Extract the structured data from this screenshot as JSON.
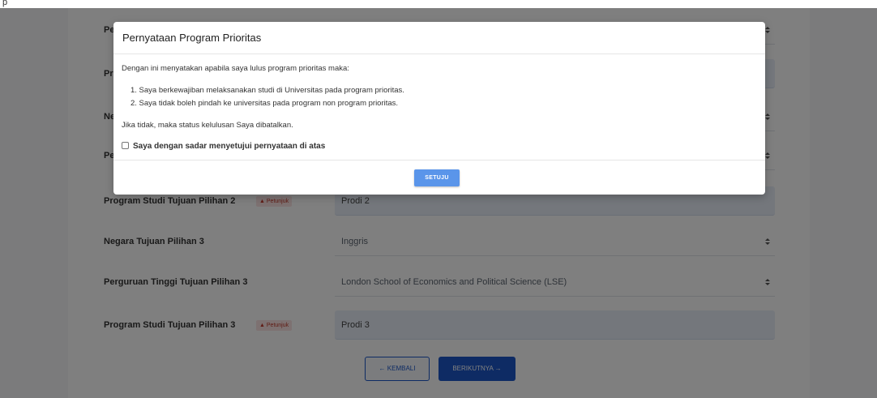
{
  "topbar": {
    "glyph": "p"
  },
  "form": {
    "hidden_labels": [
      "Pe",
      "Pro",
      "Ne",
      "Pe"
    ],
    "rows": [
      {
        "label": "Program Studi Tujuan Pilihan 2",
        "badge": "Petunjuk",
        "value": "Prodi 2",
        "kind": "input"
      },
      {
        "label": "Negara Tujuan Pilihan 3",
        "value": "Inggris",
        "kind": "select"
      },
      {
        "label": "Perguruan Tinggi Tujuan Pilihan 3",
        "value": "London School of Economics and Political Science (LSE)",
        "kind": "select"
      },
      {
        "label": "Program Studi Tujuan Pilihan 3",
        "badge": "Petunjuk",
        "value": "Prodi 3",
        "kind": "input"
      }
    ],
    "back_label": "← KEMBALI",
    "next_label": "BERIKUTNYA →"
  },
  "modal": {
    "title": "Pernyataan Program Prioritas",
    "intro": "Dengan ini menyatakan apabila saya lulus program prioritas maka:",
    "items": [
      "1. Saya berkewajiban melaksanakan studi di Universitas pada program prioritas.",
      "2. Saya tidak boleh pindah ke universitas pada program non program prioritas."
    ],
    "after": "Jika tidak, maka status kelulusan Saya dibatalkan.",
    "checkbox_label": "Saya dengan sadar menyetujui pernyataan di atas",
    "checkbox_checked": false,
    "confirm_label": "SETUJU"
  },
  "colors": {
    "primary": "#1c57c8",
    "confirm": "#5a95ea",
    "badge_text": "#c0392b",
    "badge_bg": "#fbe3e3",
    "input_bg": "#e8eef8",
    "backdrop": "rgba(0,0,0,0.5)"
  },
  "icons": {
    "warning": "warning-icon",
    "select_arrow": "select-arrow-icon"
  }
}
